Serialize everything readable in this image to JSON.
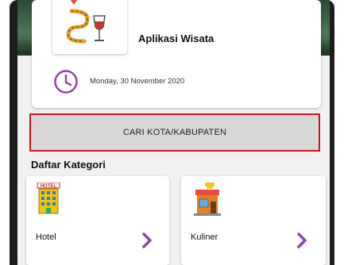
{
  "header": {
    "app_title": "Aplikasi Wisata",
    "date": "Monday, 30 November 2020"
  },
  "search": {
    "label": "CARI KOTA/KABUPATEN"
  },
  "categories": {
    "title": "Daftar Kategori",
    "items": [
      {
        "label": "Hotel",
        "sign": "HOTEL",
        "icon": "hotel-icon"
      },
      {
        "label": "Kuliner",
        "icon": "restaurant-icon"
      }
    ]
  },
  "colors": {
    "accent": "#8e44ad",
    "search_border": "#c8141e",
    "search_bg": "#d8d8d8",
    "chevron": "#8e44ad"
  }
}
